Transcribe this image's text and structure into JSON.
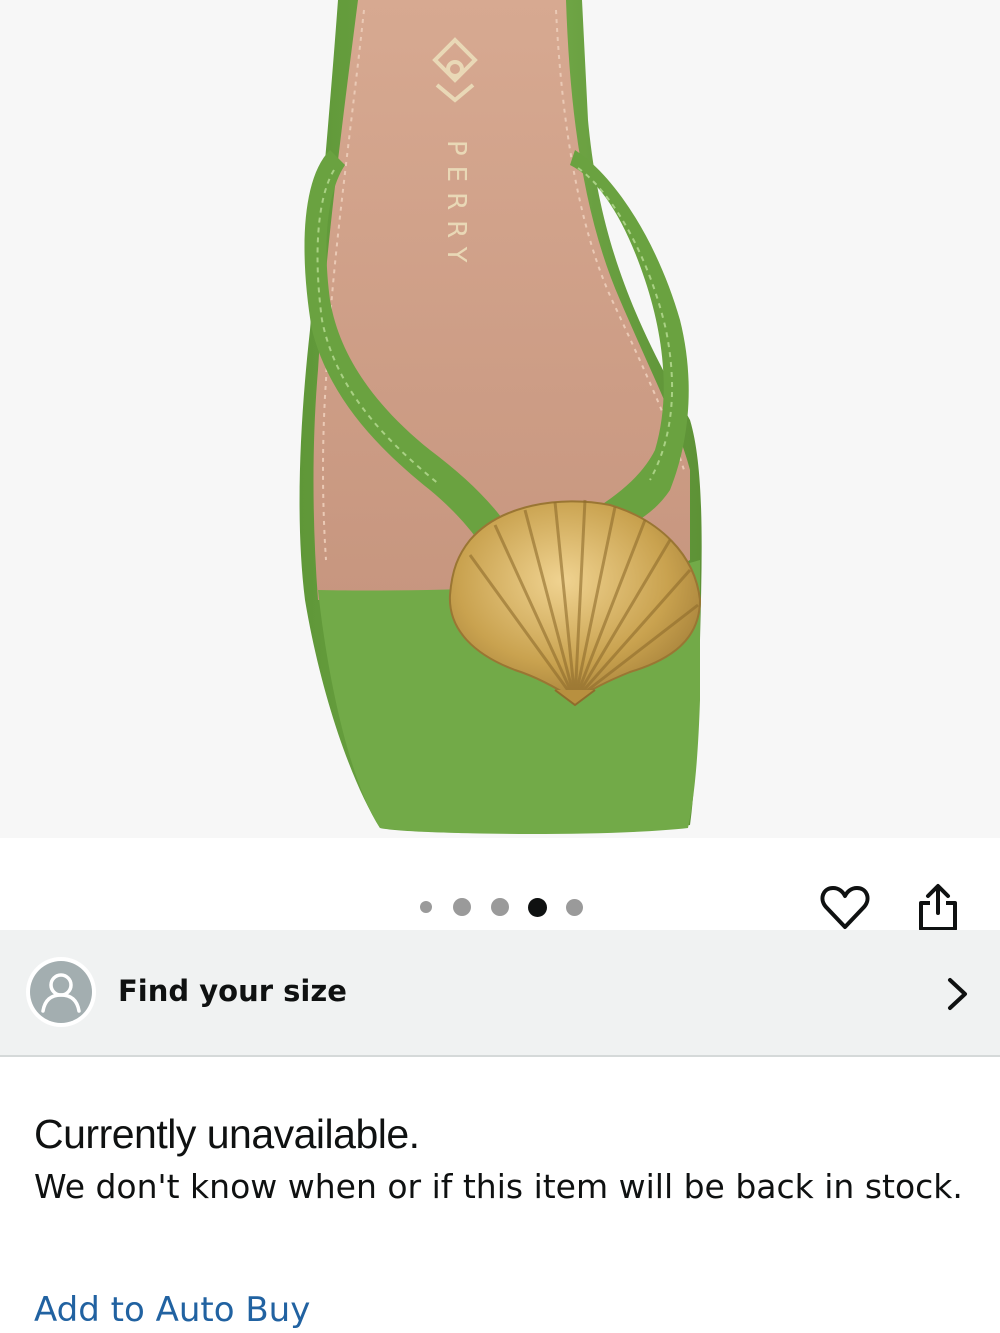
{
  "product_image": {
    "brand_text": "PERRY",
    "colors": {
      "background": "#f7f7f7",
      "shoe_green": "#6fa546",
      "insole": "#cfa38d",
      "shell_gold": "#c9a45a"
    }
  },
  "carousel": {
    "dot_count": 5,
    "active_index": 3
  },
  "actions": {
    "wishlist_icon": "heart-icon",
    "share_icon": "share-icon"
  },
  "size_finder": {
    "avatar_icon": "user-icon",
    "label": "Find your size",
    "chevron_icon": "chevron-right-icon"
  },
  "availability": {
    "title": "Currently unavailable.",
    "message": "We don't know when or if this item will be back in stock."
  },
  "auto_buy": {
    "label": "Add to Auto Buy",
    "color": "#2162a1"
  }
}
